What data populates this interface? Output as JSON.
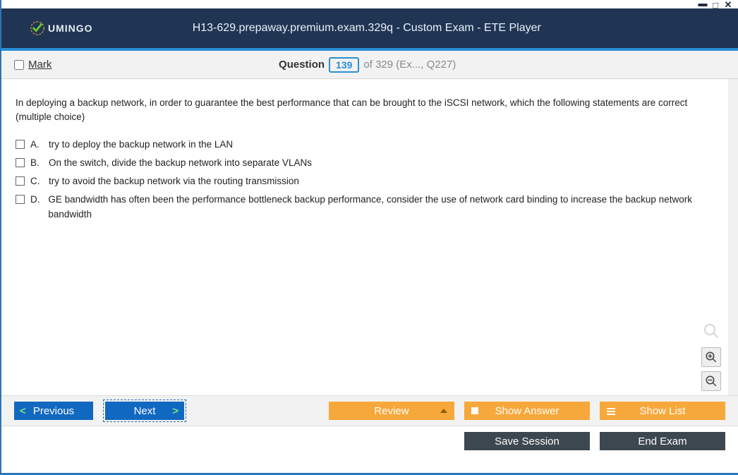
{
  "window": {
    "brand": "UMINGO",
    "title": "H13-629.prepaway.premium.exam.329q - Custom Exam - ETE Player"
  },
  "questionbar": {
    "mark_label": "Mark",
    "q_label": "Question",
    "q_number": "139",
    "q_suffix": "of 329 (Ex..., Q227)"
  },
  "question": {
    "text": "In deploying a backup network, in order to guarantee the best performance that can be brought to the iSCSI network, which the following statements are correct (multiple choice)",
    "choices": [
      {
        "letter": "A.",
        "text": "try to deploy the backup network in the LAN"
      },
      {
        "letter": "B.",
        "text": "On the switch, divide the backup network into separate VLANs"
      },
      {
        "letter": "C.",
        "text": "try to avoid the backup network via the routing transmission"
      },
      {
        "letter": "D.",
        "text": "GE bandwidth has often been the performance bottleneck backup performance, consider the use of network card binding to increase the backup network bandwidth"
      }
    ]
  },
  "buttons": {
    "previous": "Previous",
    "next": "Next",
    "review": "Review",
    "show_answer": "Show Answer",
    "show_list": "Show List",
    "save_session": "Save Session",
    "end_exam": "End Exam"
  }
}
